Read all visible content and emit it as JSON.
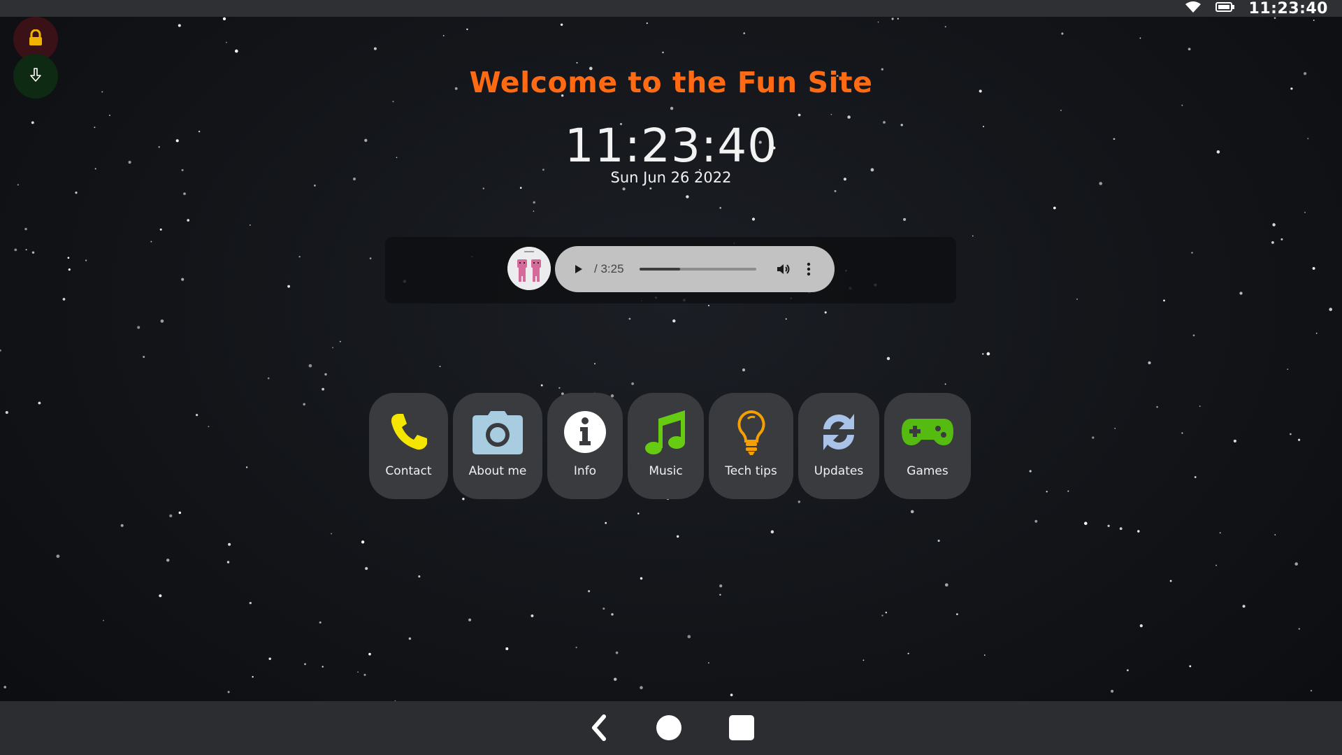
{
  "status_bar": {
    "wifi_icon": "wifi-icon",
    "battery_icon": "battery-icon",
    "time": "11:23:40"
  },
  "floating_buttons": [
    {
      "icon": "lock-icon",
      "color": "#f0b400"
    },
    {
      "icon": "download-arrow-icon",
      "color": "#ffffff"
    }
  ],
  "header": {
    "title": "Welcome to the Fun Site",
    "title_color": "#ff6a13",
    "clock": "11:23:40",
    "date": "Sun Jun 26 2022"
  },
  "player": {
    "album_art_icon": "friends-album-art",
    "time_display": " / 3:25",
    "progress": 0.35
  },
  "apps": [
    {
      "label": "Contact",
      "icon": "phone-icon",
      "color": "#f5e600"
    },
    {
      "label": "About me",
      "icon": "camera-icon",
      "color": "#a9cde0"
    },
    {
      "label": "Info",
      "icon": "info-icon",
      "color": "#ffffff"
    },
    {
      "label": "Music",
      "icon": "music-note-icon",
      "color": "#66cc11"
    },
    {
      "label": "Tech tips",
      "icon": "lightbulb-icon",
      "color": "#f5a000"
    },
    {
      "label": "Updates",
      "icon": "refresh-icon",
      "color": "#a9c2e8"
    },
    {
      "label": "Games",
      "icon": "gamepad-icon",
      "color": "#55bb11"
    }
  ],
  "nav": {
    "back_icon": "back-icon",
    "home_icon": "home-icon",
    "recents_icon": "recents-icon"
  }
}
